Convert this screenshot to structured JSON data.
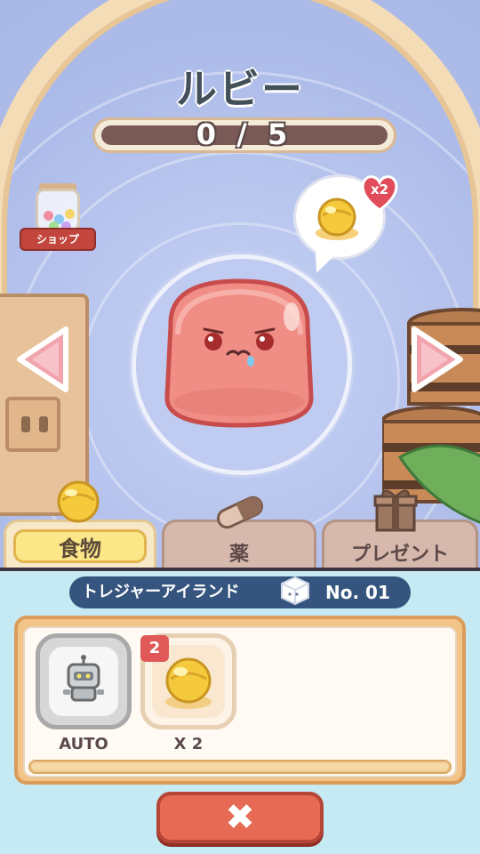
{
  "header": {
    "title": "ルビー",
    "progress_text": "0 / 5",
    "progress_fraction": 0.0
  },
  "shop": {
    "label": "ショップ"
  },
  "wish_bubble": {
    "multiplier": "x2"
  },
  "tabs": [
    {
      "label": "食物",
      "active": true
    },
    {
      "label": "薬",
      "active": false
    },
    {
      "label": "プレゼント",
      "active": false
    }
  ],
  "island": {
    "name": "トレジャーアイランド",
    "number": "No. 01"
  },
  "inventory": [
    {
      "label": "AUTO",
      "icon": "robot-icon"
    },
    {
      "label": "X 2",
      "icon": "golden-candy-icon",
      "count": "2"
    }
  ],
  "colors": {
    "accent_red": "#e76a55",
    "panel_orange": "#f2c487",
    "bar_navy": "#35557e",
    "active_tab_yellow": "#fce788"
  }
}
